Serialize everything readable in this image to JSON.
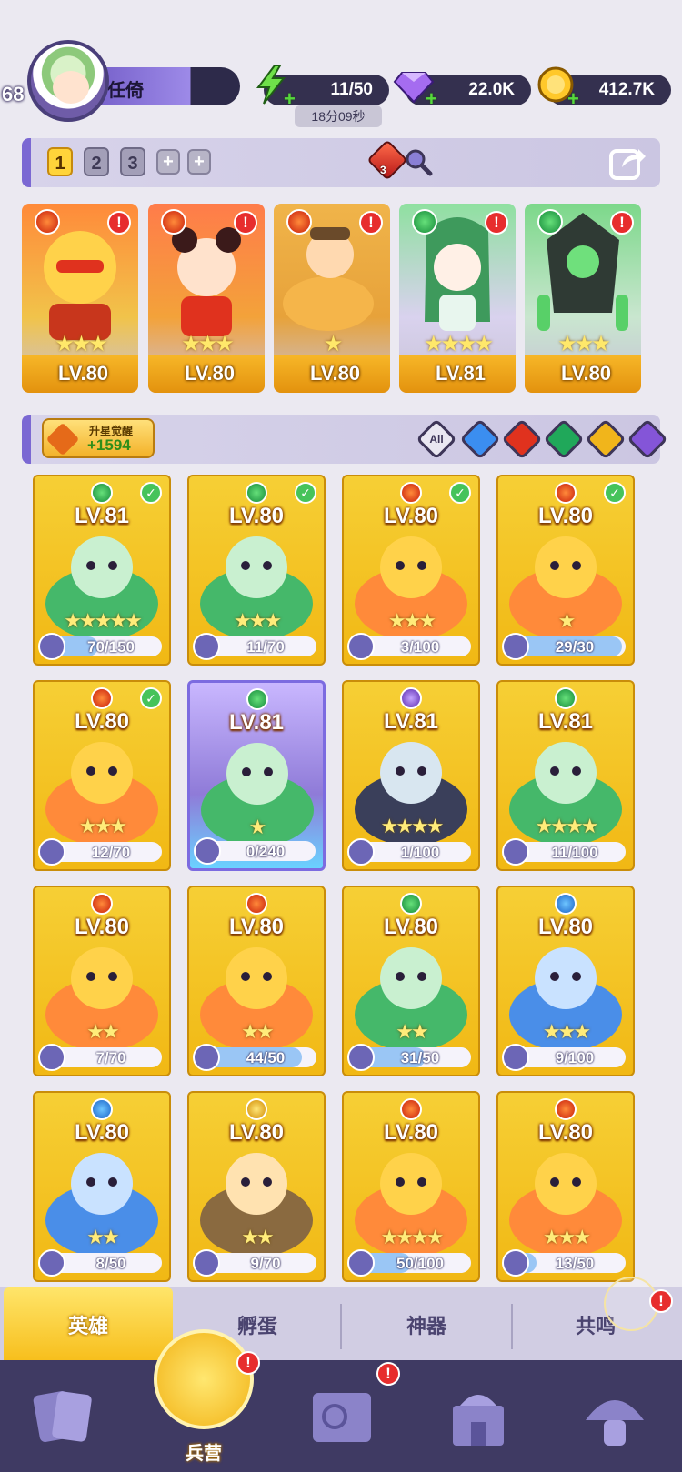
{
  "player": {
    "level": "68",
    "name": "任倚"
  },
  "resources": {
    "energy": {
      "value": "11/50",
      "timer": "18分09秒",
      "icon": "lightning-icon"
    },
    "gems": {
      "value": "22.0K",
      "icon": "diamond-icon"
    },
    "gold": {
      "value": "412.7K",
      "icon": "coin-icon"
    }
  },
  "team_bar": {
    "tabs": [
      "1",
      "2",
      "3",
      "+",
      "+"
    ],
    "active_tab": "1",
    "element_count": "3"
  },
  "team": [
    {
      "element": "fire",
      "stars": "★★★",
      "level": "LV.80",
      "alert": "!"
    },
    {
      "element": "fire",
      "stars": "★★★",
      "level": "LV.80",
      "alert": "!"
    },
    {
      "element": "fire",
      "stars": "★",
      "level": "LV.80",
      "alert": "!"
    },
    {
      "element": "wind",
      "stars": "★★★★",
      "level": "LV.81",
      "alert": "!"
    },
    {
      "element": "wind",
      "stars": "★★★",
      "level": "LV.80",
      "alert": "!"
    }
  ],
  "filter_bar": {
    "awaken_title": "升星觉醒",
    "awaken_value": "+1594",
    "filters": [
      "All",
      "water",
      "fire",
      "wind",
      "light",
      "dark"
    ]
  },
  "roster": [
    {
      "element": "wind",
      "level": "LV.81",
      "stars": "★★★★★",
      "progress": "70/150",
      "ratio": 0.47,
      "checked": true
    },
    {
      "element": "wind",
      "level": "LV.80",
      "stars": "★★★",
      "progress": "11/70",
      "ratio": 0.16,
      "checked": true
    },
    {
      "element": "fire",
      "level": "LV.80",
      "stars": "★★★",
      "progress": "3/100",
      "ratio": 0.03,
      "checked": true
    },
    {
      "element": "fire",
      "level": "LV.80",
      "stars": "★",
      "progress": "29/30",
      "ratio": 0.97,
      "checked": true
    },
    {
      "element": "fire",
      "level": "LV.80",
      "stars": "★★★",
      "progress": "12/70",
      "ratio": 0.17,
      "checked": true
    },
    {
      "element": "wind",
      "level": "LV.81",
      "stars": "★",
      "progress": "0/240",
      "ratio": 0,
      "checked": false,
      "rare": true
    },
    {
      "element": "dark",
      "level": "LV.81",
      "stars": "★★★★",
      "progress": "1/100",
      "ratio": 0.01,
      "checked": false
    },
    {
      "element": "wind",
      "level": "LV.81",
      "stars": "★★★★",
      "progress": "11/100",
      "ratio": 0.11,
      "checked": false
    },
    {
      "element": "fire",
      "level": "LV.80",
      "stars": "★★",
      "progress": "7/70",
      "ratio": 0.1,
      "checked": false
    },
    {
      "element": "fire",
      "level": "LV.80",
      "stars": "★★",
      "progress": "44/50",
      "ratio": 0.88,
      "checked": false
    },
    {
      "element": "wind",
      "level": "LV.80",
      "stars": "★★",
      "progress": "31/50",
      "ratio": 0.62,
      "checked": false
    },
    {
      "element": "water",
      "level": "LV.80",
      "stars": "★★★",
      "progress": "9/100",
      "ratio": 0.09,
      "checked": false
    },
    {
      "element": "water",
      "level": "LV.80",
      "stars": "★★",
      "progress": "8/50",
      "ratio": 0.16,
      "checked": false
    },
    {
      "element": "light",
      "level": "LV.80",
      "stars": "★★",
      "progress": "9/70",
      "ratio": 0.13,
      "checked": false
    },
    {
      "element": "fire",
      "level": "LV.80",
      "stars": "★★★★",
      "progress": "50/100",
      "ratio": 0.5,
      "checked": false
    },
    {
      "element": "fire",
      "level": "LV.80",
      "stars": "★★★",
      "progress": "13/50",
      "ratio": 0.26,
      "checked": false
    }
  ],
  "sub_tabs": [
    "英雄",
    "孵蛋",
    "神器",
    "共鸣"
  ],
  "nav": {
    "active_label": "兵营",
    "alert": "!"
  },
  "colors": {
    "accent": "#7b68d3",
    "gold": "#f3b814",
    "nav_bg": "#3f3a63"
  }
}
